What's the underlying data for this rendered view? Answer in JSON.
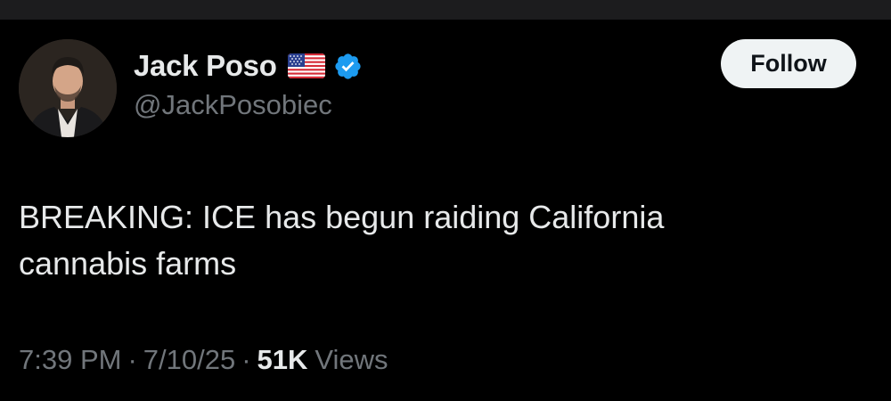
{
  "author": {
    "display_name": "Jack Poso",
    "handle": "@JackPosobiec",
    "flag_icon": "us-flag-icon",
    "verified_icon": "verified-badge-icon",
    "verified_color": "#1d9bf0"
  },
  "follow_button": {
    "label": "Follow"
  },
  "tweet": {
    "text": "BREAKING: ICE has begun raiding California\ncannabis farms",
    "time": "7:39 PM",
    "separator": "·",
    "date": "7/10/25",
    "views_count": "51K",
    "views_label": "Views"
  },
  "colors": {
    "background": "#000000",
    "text_primary": "#e7e9ea",
    "text_secondary": "#71767b",
    "button_bg": "#eff3f4"
  }
}
